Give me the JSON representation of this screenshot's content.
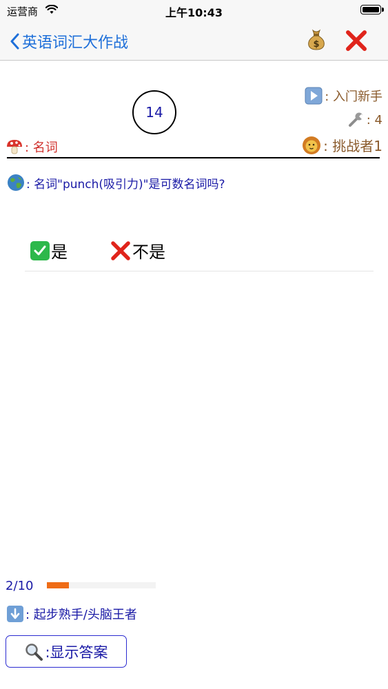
{
  "status_bar": {
    "carrier": "运营商",
    "time": "上午10:43"
  },
  "nav": {
    "back_label": "英语词汇大作战"
  },
  "game": {
    "timer": "14",
    "level_label": ": 入门新手",
    "tool_count": ": 4",
    "player_label": ": 挑战者1",
    "category_label": ": 名词"
  },
  "question": {
    "text": ": 名词\"punch(吸引力)\"是可数名词吗?"
  },
  "answers": {
    "yes_label": "是",
    "no_label": "不是"
  },
  "progress": {
    "text": "2/10",
    "value": 0.2
  },
  "footer": {
    "level_path": ": 起步熟手/头脑王者",
    "show_answer_label": ":显示答案"
  },
  "colors": {
    "accent": "#1e6fd9",
    "progress": "#ef6c16",
    "text_blue": "#1a1aa6",
    "brown": "#8a5a2b",
    "red": "#d0312d"
  },
  "icons": [
    "wifi-icon",
    "battery-icon",
    "chevron-left-icon",
    "money-bag-icon",
    "close-icon",
    "play-icon",
    "wrench-icon",
    "lion-icon",
    "mushroom-icon",
    "globe-icon",
    "check-icon",
    "cross-icon",
    "down-arrow-icon",
    "magnifier-icon"
  ]
}
